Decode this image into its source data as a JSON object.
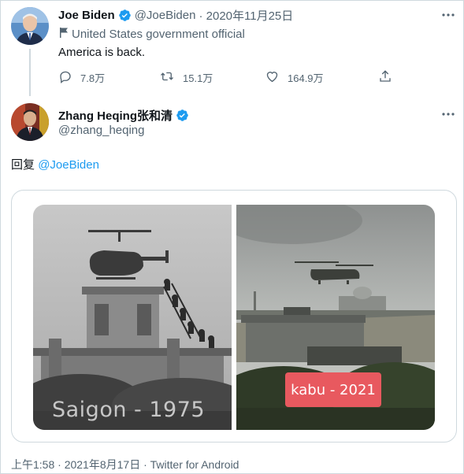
{
  "original_tweet": {
    "author_name": "Joe Biden",
    "author_handle": "@JoeBiden",
    "date": "· 2020年11月25日",
    "gov_label": "United States government official",
    "text": "America is back.",
    "reply_count": "7.8万",
    "retweet_count": "15.1万",
    "like_count": "164.9万"
  },
  "reply_tweet": {
    "author_name": "Zhang Heqing张和清",
    "author_handle": "@zhang_heqing",
    "reply_prefix": "回复",
    "reply_mention": "@JoeBiden",
    "image_left_caption": "Saigon - 1975",
    "image_right_caption": "kabu - 2021",
    "timestamp": "上午1:58 · 2021年8月17日 · Twitter for Android"
  },
  "colors": {
    "accent": "#1d9bf0",
    "secondary_text": "#536471",
    "badge_red": "#e8595f"
  },
  "icons": [
    "verified-badge-icon",
    "more-icon",
    "flag-icon",
    "reply-icon",
    "retweet-icon",
    "like-icon",
    "share-icon"
  ]
}
